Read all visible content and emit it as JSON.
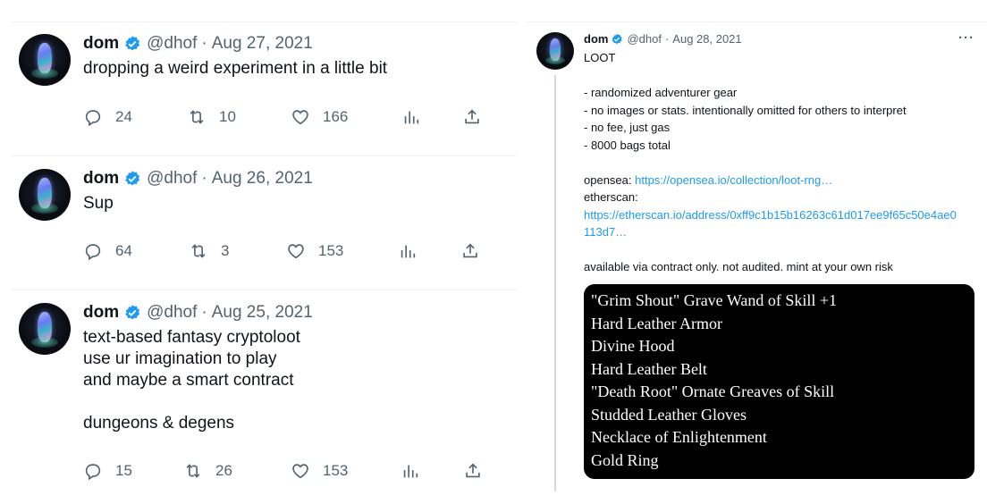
{
  "colors": {
    "accent": "#1d9bf0",
    "muted": "#536471",
    "text": "#0f1419",
    "verified": "#1d9bf0"
  },
  "left_tweets": [
    {
      "name": "dom",
      "handle": "@dhof",
      "date": "Aug 27, 2021",
      "text": "dropping a weird experiment in a little bit",
      "replies": "24",
      "retweets": "10",
      "likes": "166"
    },
    {
      "name": "dom",
      "handle": "@dhof",
      "date": "Aug 26, 2021",
      "text": "Sup",
      "replies": "64",
      "retweets": "3",
      "likes": "153"
    },
    {
      "name": "dom",
      "handle": "@dhof",
      "date": "Aug 25, 2021",
      "text": "text-based fantasy cryptoloot\nuse ur imagination to play\nand maybe a smart contract\n\ndungeons & degens",
      "replies": "15",
      "retweets": "26",
      "likes": "153"
    }
  ],
  "right_tweet": {
    "name": "dom",
    "handle": "@dhof",
    "date": "Aug 28, 2021",
    "more": "···",
    "lines": {
      "l1": "LOOT",
      "l2": "- randomized adventurer gear",
      "l3": "- no images or stats. intentionally omitted for others to interpret",
      "l4": "- no fee, just gas",
      "l5": "- 8000 bags total",
      "opensea_label": "opensea: ",
      "opensea_link": "https://opensea.io/collection/loot-rng…",
      "etherscan_label": "etherscan:",
      "etherscan_link_1": "https://etherscan.io/address/0xff9c1b15b16263c61d017ee9f65c50e4ae0",
      "etherscan_link_2": "113d7…",
      "footer": "available via contract only. not audited. mint at your own risk"
    },
    "loot_items": [
      "\"Grim Shout\" Grave Wand of Skill +1",
      "Hard Leather Armor",
      "Divine Hood",
      "Hard Leather Belt",
      "\"Death Root\" Ornate Greaves of Skill",
      "Studded Leather Gloves",
      "Necklace of Enlightenment",
      "Gold Ring"
    ]
  },
  "icons": {
    "reply": "reply-icon",
    "retweet": "retweet-icon",
    "like": "heart-icon",
    "views": "analytics-icon",
    "share": "share-icon",
    "verified": "verified-badge-icon",
    "more": "more-icon"
  }
}
